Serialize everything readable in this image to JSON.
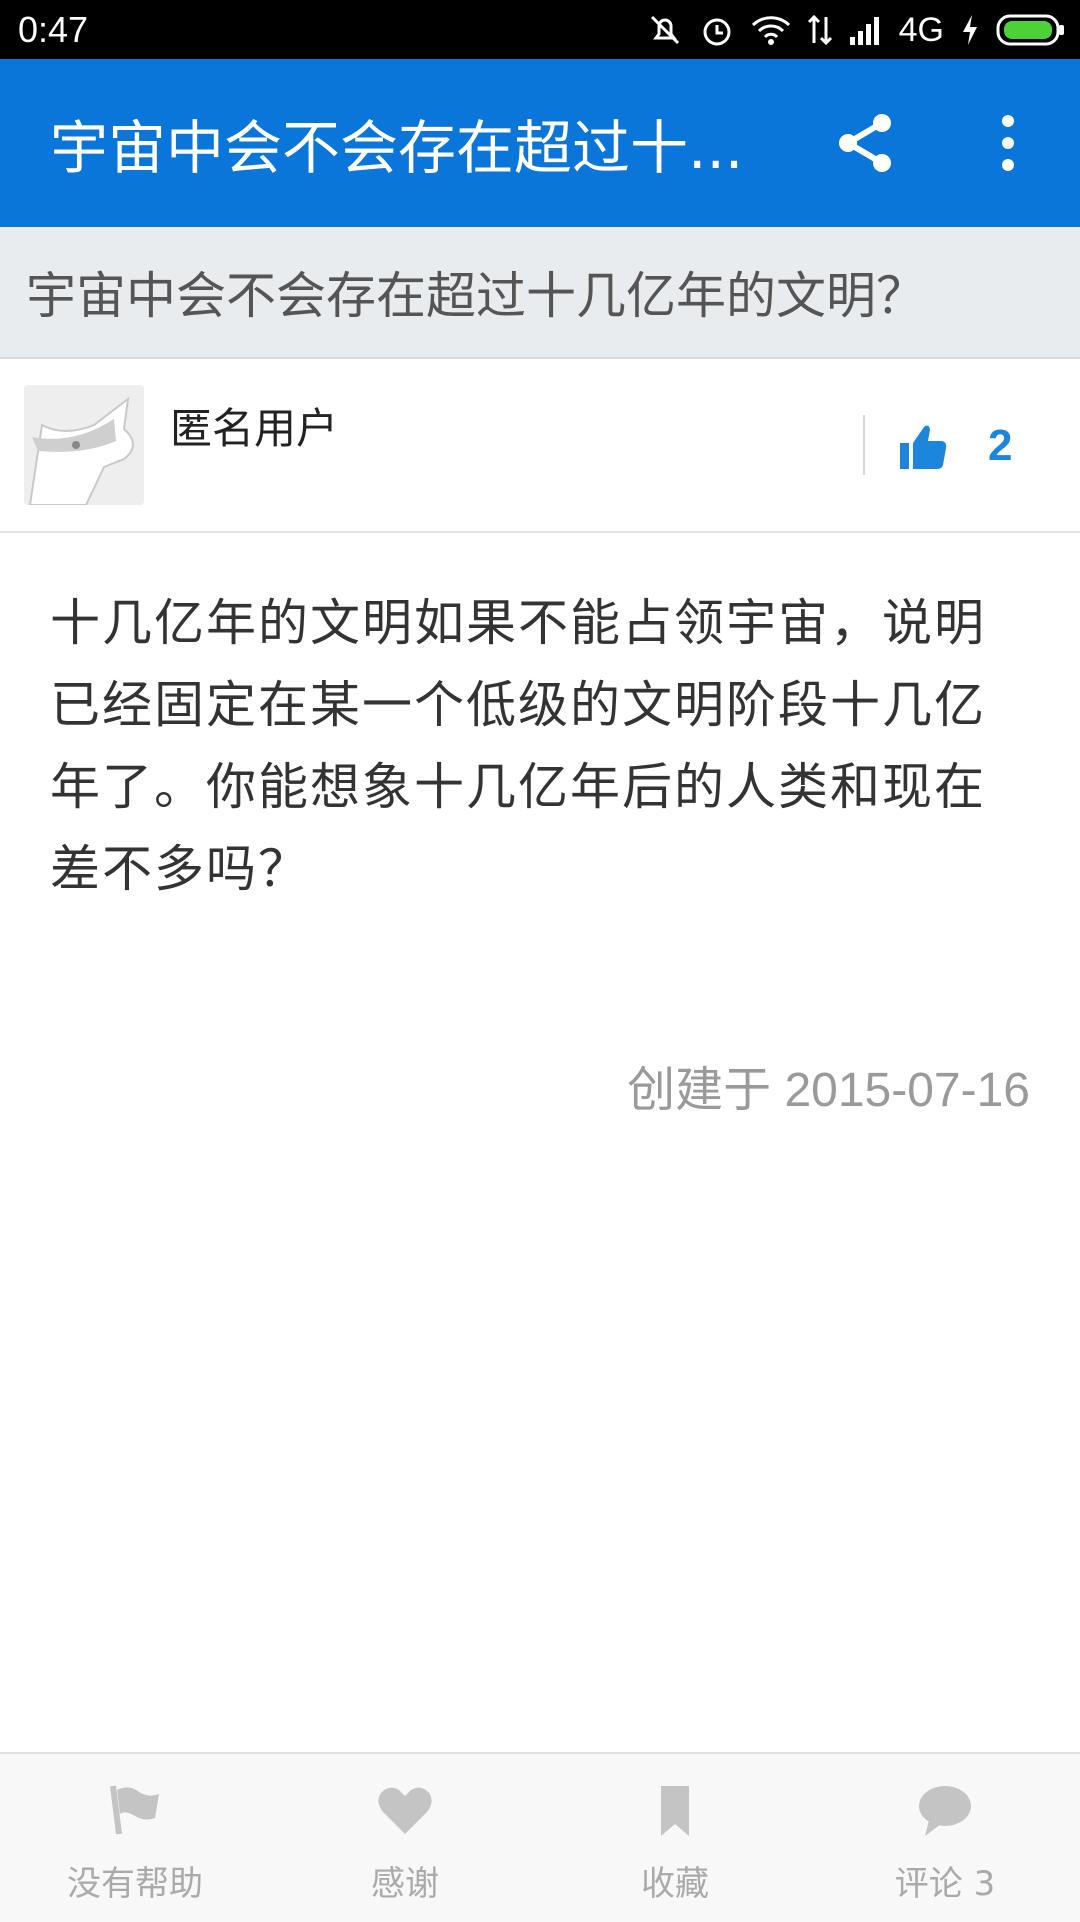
{
  "status_bar": {
    "time": "0:47",
    "network": "4G",
    "icons": [
      "mute-icon",
      "alarm-icon",
      "wifi-icon",
      "data-transfer-icon",
      "signal-icon",
      "charging-icon",
      "battery-icon"
    ]
  },
  "app_bar": {
    "title": "宇宙中会不会存在超过十...",
    "actions": [
      "share-icon",
      "more-vert-icon"
    ],
    "color": "#0b76d9"
  },
  "question": {
    "title": "宇宙中会不会存在超过十几亿年的文明？"
  },
  "answer": {
    "author": "匿名用户",
    "votes": "2",
    "body": "十几亿年的文明如果不能占领宇宙，说明已经固定在某一个低级的文明阶段十几亿年了。你能想象十几亿年后的人类和现在差不多吗？",
    "created": "创建于 2015-07-16"
  },
  "bottom_bar": {
    "actions": [
      {
        "label": "没有帮助",
        "icon": "flag-icon"
      },
      {
        "label": "感谢",
        "icon": "heart-icon"
      },
      {
        "label": "收藏",
        "icon": "bookmark-icon"
      },
      {
        "label": "评论 3",
        "icon": "comment-icon"
      }
    ]
  }
}
